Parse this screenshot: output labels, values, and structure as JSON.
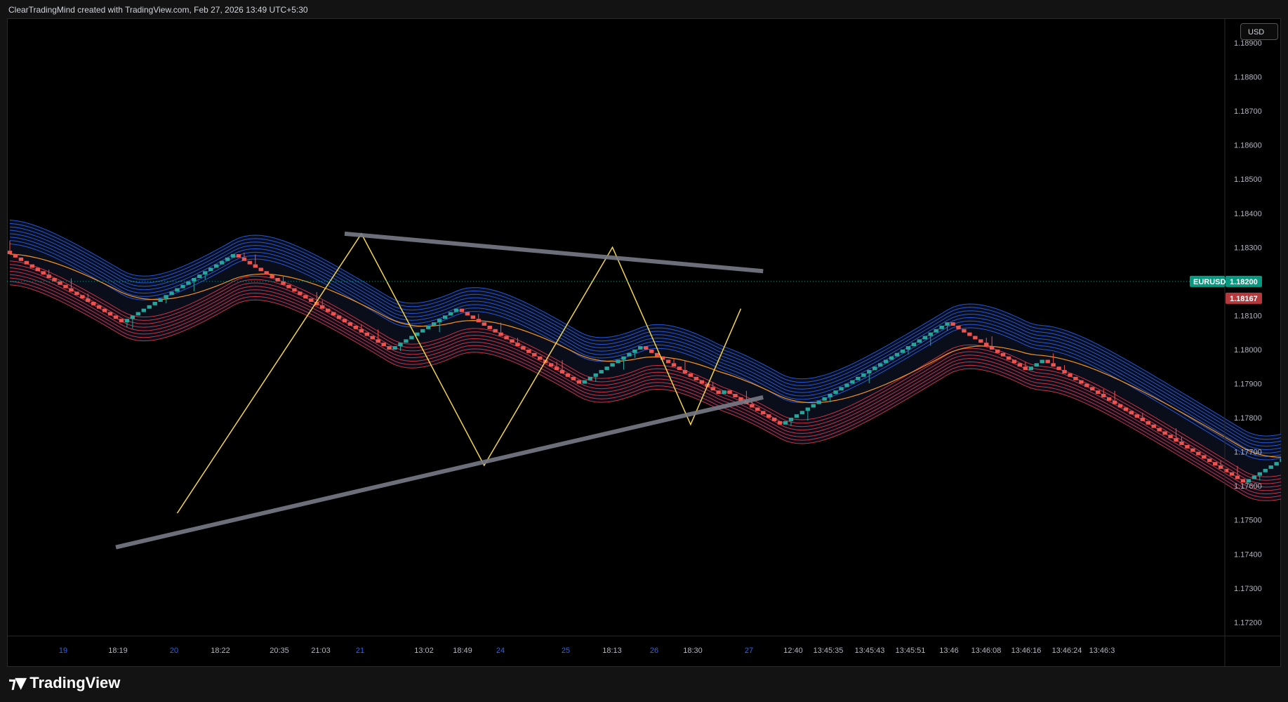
{
  "header": {
    "attribution": "ClearTradingMind created with TradingView.com, Feb 27, 2026 13:49 UTC+5:30"
  },
  "footer": {
    "logo_text": "TradingView"
  },
  "price_axis": {
    "currency_button": "USD",
    "symbol_label": "EURUSD",
    "last_price": "1.18200",
    "prev_price": "1.18167",
    "symbol_color": "#089981",
    "prev_color": "#b5383d"
  },
  "colors": {
    "up": "#26a69a",
    "down": "#ef5350",
    "upper_band": "#2962ff",
    "lower_band": "#f23645",
    "ma": "#f7931a",
    "zigzag": "#f5d547",
    "trendline": "#787b86"
  },
  "chart_data": {
    "type": "candlestick",
    "title": "",
    "symbol": "EURUSD",
    "y_ticks": [
      "1.18900",
      "1.18800",
      "1.18700",
      "1.18600",
      "1.18500",
      "1.18400",
      "1.18300",
      "1.18200",
      "1.18100",
      "1.18000",
      "1.17900",
      "1.17800",
      "1.17700",
      "1.17600",
      "1.17500",
      "1.17400",
      "1.17300",
      "1.17200"
    ],
    "ylim": [
      1.1715,
      1.1907
    ],
    "x_ticks": [
      "19",
      "18:19",
      "20",
      "18:22",
      "20:35",
      "21:03",
      "21",
      "13:02",
      "18:49",
      "24",
      "25",
      "18:13",
      "26",
      "18:30",
      "27",
      "12:40",
      "13:45:35",
      "13:45:43",
      "13:45:51",
      "13:46",
      "13:46:08",
      "13:46:16",
      "13:46:24",
      "13:46:3"
    ],
    "renko_box": 0.0001,
    "pivots": [
      1.1829,
      1.1808,
      1.1828,
      1.1823,
      1.18,
      1.1812,
      1.181,
      1.179,
      1.1796,
      1.1801,
      1.1787,
      1.1788,
      1.1778,
      1.1807,
      1.1808,
      1.1794,
      1.1797,
      1.1785,
      1.1778,
      1.1761,
      1.1788,
      1.1769,
      1.1774,
      1.1769,
      1.1754,
      1.1751,
      1.1746,
      1.1768,
      1.1753,
      1.1779,
      1.177,
      1.1779,
      1.1767,
      1.178,
      1.1758,
      1.1766,
      1.1763,
      1.1783,
      1.1762,
      1.1783,
      1.1773,
      1.176,
      1.1783,
      1.1777,
      1.1804,
      1.18,
      1.1801,
      1.1793,
      1.1799,
      1.1787,
      1.1799,
      1.1792,
      1.1805,
      1.18,
      1.1799,
      1.1775,
      1.1786,
      1.177,
      1.1795,
      1.1786,
      1.1808,
      1.1783,
      1.1799,
      1.1795,
      1.1803,
      1.179,
      1.1796,
      1.1788,
      1.1796,
      1.1779,
      1.182,
      1.1815,
      1.1805,
      1.1811,
      1.1804,
      1.1819,
      1.1815,
      1.1811,
      1.1795,
      1.182,
      1.1814,
      1.1789,
      1.1797,
      1.1791,
      1.1797,
      1.1793,
      1.1797,
      1.1787,
      1.1787,
      1.1778,
      1.1789,
      1.1783,
      1.1783,
      1.1775,
      1.1775,
      1.177,
      1.1787,
      1.1778,
      1.1788,
      1.1774,
      1.1782,
      1.1771,
      1.1802,
      1.1794,
      1.1804,
      1.179,
      1.1806,
      1.18,
      1.18,
      1.179,
      1.18,
      1.1794,
      1.1806,
      1.1801,
      1.1827,
      1.1811,
      1.1821,
      1.181,
      1.1822,
      1.1805,
      1.1816,
      1.1801,
      1.1793,
      1.178,
      1.1787,
      1.1778,
      1.1787,
      1.1785,
      1.1793,
      1.1789,
      1.1792,
      1.1801,
      1.1798,
      1.182
    ],
    "zigzag": [
      {
        "i": 30,
        "price": 1.1752
      },
      {
        "i": 63,
        "price": 1.1834
      },
      {
        "i": 85,
        "price": 1.1766
      },
      {
        "i": 108,
        "price": 1.183
      },
      {
        "i": 122,
        "price": 1.1778
      },
      {
        "i": 131,
        "price": 1.1812
      }
    ],
    "trendlines": [
      {
        "name": "resistance",
        "from": {
          "i": 60,
          "price": 1.1834
        },
        "to": {
          "i": 135,
          "price": 1.1823
        }
      },
      {
        "name": "support",
        "from": {
          "i": 19,
          "price": 1.1742
        },
        "to": {
          "i": 135,
          "price": 1.1786
        }
      }
    ],
    "bands": {
      "upper_count": 8,
      "lower_count": 8,
      "moving_average_count": 1
    },
    "grid": false,
    "legend": "none"
  }
}
